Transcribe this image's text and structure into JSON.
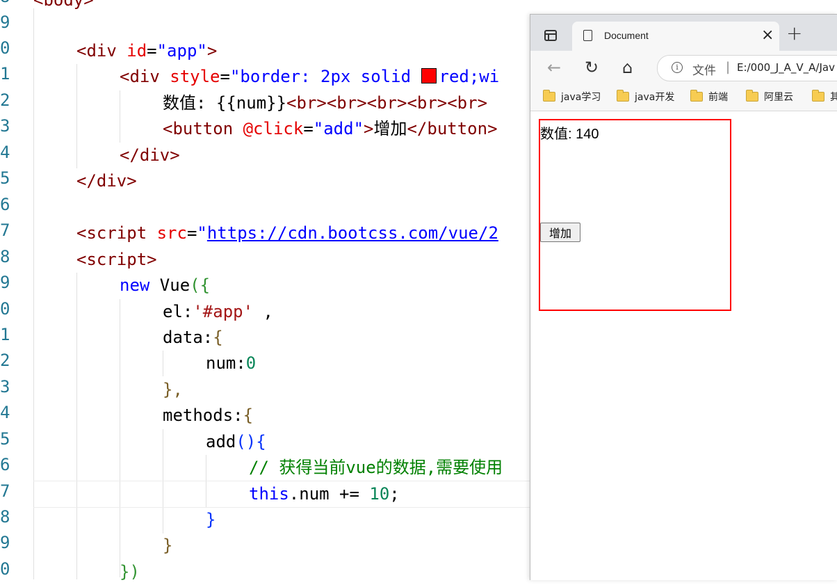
{
  "editor": {
    "line_numbers": [
      "8",
      "9",
      "0",
      "1",
      "2",
      "3",
      "4",
      "5",
      "6",
      "7",
      "8",
      "9",
      "0",
      "1",
      "2",
      "3",
      "4",
      "5",
      "6",
      "7",
      "8",
      "9",
      "0"
    ],
    "lines": {
      "l8": "<body>",
      "l10_open": "<div",
      "l10_attr": " id",
      "l10_eq": "=",
      "l10_val": "\"app\"",
      "l10_close": ">",
      "l11_open": "<div",
      "l11_attr": " style",
      "l11_eq": "=",
      "l11_val_a": "\"border: 2px solid ",
      "l11_val_b": "red;wi",
      "l12_text": "数值: {{num}}",
      "l12_tags": "<br><br><br><br><br>",
      "l13_open": "<button",
      "l13_attr": " @click",
      "l13_eq": "=",
      "l13_val": "\"add\"",
      "l13_gt": ">",
      "l13_text": "增加",
      "l13_close": "</button>",
      "l14": "</div>",
      "l15": "</div>",
      "l17_open": "<script",
      "l17_attr": " src",
      "l17_eq": "=",
      "l17_q": "\"",
      "l17_url": "https://cdn.bootcss.com/vue/2",
      "l18": "<script>",
      "l19_kw": "new",
      "l19_text": " Vue",
      "l19_brace": "({",
      "l20_key": "el:",
      "l20_val": "'#app'",
      "l20_rest": " ,",
      "l21_key": "data:",
      "l21_brace": "{",
      "l22_key": "num:",
      "l22_val": "0",
      "l23": "},",
      "l24_key": "methods:",
      "l24_brace": "{",
      "l25_fn": "add",
      "l25_paren": "(){",
      "l26_comment": "// 获得当前vue的数据,需要使用",
      "l27_kw": "this",
      "l27_rest": ".num += ",
      "l27_num": "10",
      "l27_semi": ";",
      "l28": "}",
      "l29": "}",
      "l30": "})"
    }
  },
  "browser": {
    "tab_title": "Document",
    "tab_close": "×",
    "new_tab": "+",
    "back": "←",
    "reload": "↻",
    "home": "⌂",
    "address_label": "文件",
    "address_sep": "|",
    "address_url": "E:/000_J_A_V_A/Jav",
    "info_glyph": "i",
    "bookmarks": [
      "java学习",
      "java开发",
      "前端",
      "阿里云",
      "其"
    ],
    "page": {
      "num_text": "数值: 140",
      "button_label": "增加"
    }
  },
  "icons": {
    "sidebar": "sidebar-toggle-icon",
    "page": "page-icon",
    "folder": "folder-icon",
    "info": "info-icon"
  },
  "colors": {
    "box_border": "#ff0000",
    "tag": "#800000",
    "attr": "#e50000",
    "string": "#0000ff",
    "number": "#098658",
    "comment": "#008000"
  }
}
